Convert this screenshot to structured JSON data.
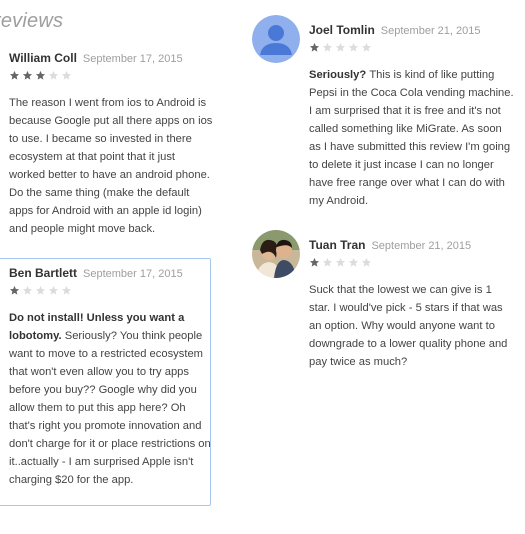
{
  "section": {
    "title": "reviews"
  },
  "colors": {
    "star_filled": "#666666",
    "star_empty": "#dcdcdc",
    "card_border": "#a5c8ea",
    "avatar_default": "#4a78d6"
  },
  "reviews": [
    {
      "author": "William Coll",
      "date": "September 17, 2015",
      "rating": 3,
      "headline": "",
      "text": "The reason I went from ios to Android is because Google put all there apps on ios to use. I became so invested in there ecosystem at that point that it just worked better to have an android phone. Do the same thing (make the default apps for Android with an apple id login) and people might move back."
    },
    {
      "author": "Ben Bartlett",
      "date": "September 17, 2015",
      "rating": 1,
      "headline": "Do not install! Unless you want a lobotomy.",
      "text": "Seriously? You think people want to move to a restricted ecosystem that won't even allow you to try apps before you buy?? Google why did you allow them to put this app here? Oh that's right you promote innovation and don't charge for it or place restrictions on it..actually - I am surprised Apple isn't charging $20 for the app."
    },
    {
      "author": "Joel Tomlin",
      "date": "September 21, 2015",
      "rating": 1,
      "avatar": "default-avatar-icon",
      "headline": "Seriously?",
      "text": "This is kind of like putting Pepsi in the Coca Cola vending machine. I am surprised that it is free and it's not called something like MiGrate. As soon as I have submitted this review I'm going to delete it just incase I can no longer have free range over what I can do with my Android."
    },
    {
      "author": "Tuan Tran",
      "date": "September 21, 2015",
      "rating": 1,
      "avatar": "photo-avatar",
      "headline": "",
      "text": "Suck that the lowest we can give is 1 star. I would've pick - 5 stars if that was an option. Why would anyone want to downgrade to a lower quality phone and pay twice as much?"
    }
  ]
}
